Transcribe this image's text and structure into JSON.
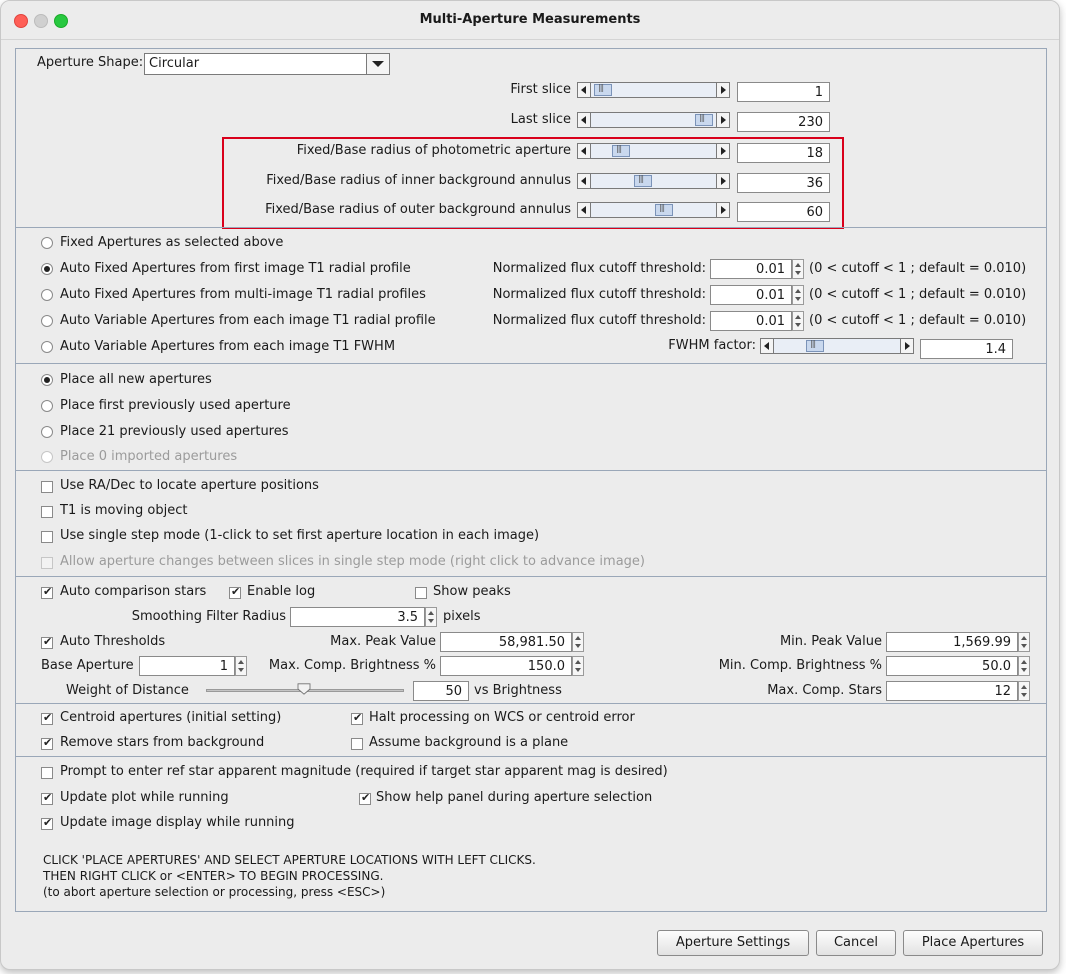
{
  "window": {
    "title": "Multi-Aperture Measurements"
  },
  "aperture_shape": {
    "label": "Aperture Shape:",
    "value": "Circular"
  },
  "sliders": {
    "first_slice": {
      "label": "First slice",
      "value": "1"
    },
    "last_slice": {
      "label": "Last slice",
      "value": "230"
    },
    "photometric": {
      "label": "Fixed/Base radius of photometric aperture",
      "value": "18"
    },
    "inner": {
      "label": "Fixed/Base radius of inner background annulus",
      "value": "36"
    },
    "outer": {
      "label": "Fixed/Base radius of outer background annulus",
      "value": "60"
    }
  },
  "aperture_mode": {
    "fixed": "Fixed Apertures as selected above",
    "auto_fixed_first": "Auto Fixed Apertures from first image T1 radial profile",
    "auto_fixed_multi": "Auto Fixed Apertures from multi-image T1 radial profiles",
    "auto_var_radial": "Auto Variable Apertures from each image T1 radial profile",
    "auto_var_fwhm": "Auto Variable Apertures from each image T1 FWHM",
    "cutoff_label": "Normalized flux cutoff threshold:",
    "cutoff_value": "0.01",
    "cutoff_hint": "(0 < cutoff < 1 ; default = 0.010)",
    "fwhm_label": "FWHM factor:",
    "fwhm_value": "1.4"
  },
  "placement": {
    "all_new": "Place all new apertures",
    "first_prev": "Place first previously used aperture",
    "prev_21": "Place 21 previously used apertures",
    "imported_0": "Place 0 imported apertures"
  },
  "options1": {
    "radec": "Use RA/Dec to locate aperture positions",
    "moving": "T1 is moving object",
    "single_step": "Use single step mode (1-click to set first aperture location in each image)",
    "allow_changes": "Allow aperture changes between slices in single step mode (right click to advance image)"
  },
  "comparison": {
    "auto_comp": "Auto comparison stars",
    "enable_log": "Enable log",
    "show_peaks": "Show peaks",
    "smoothing_label": "Smoothing Filter Radius",
    "smoothing_value": "3.5",
    "pixels": "pixels",
    "auto_thresholds": "Auto Thresholds",
    "max_peak_label": "Max. Peak Value",
    "max_peak_value": "58,981.50",
    "min_peak_label": "Min. Peak Value",
    "min_peak_value": "1,569.99",
    "base_ap_label": "Base Aperture",
    "base_ap_value": "1",
    "max_comp_label": "Max. Comp. Brightness %",
    "max_comp_value": "150.0",
    "min_comp_label": "Min. Comp. Brightness %",
    "min_comp_value": "50.0",
    "weight_label": "Weight of Distance",
    "weight_value": "50",
    "vs_brightness": "vs Brightness",
    "max_stars_label": "Max. Comp. Stars",
    "max_stars_value": "12"
  },
  "centroid": {
    "centroid_ap": "Centroid apertures (initial setting)",
    "halt": "Halt processing on WCS or centroid error",
    "remove_stars": "Remove stars from background",
    "assume_plane": "Assume background is a plane"
  },
  "misc": {
    "prompt_ref": "Prompt to enter ref star apparent magnitude (required if target star apparent mag is desired)",
    "update_plot": "Update plot while running",
    "show_help": "Show help panel during aperture selection",
    "update_image": "Update image display while running"
  },
  "instructions": {
    "line1": "CLICK 'PLACE APERTURES' AND SELECT APERTURE LOCATIONS WITH LEFT CLICKS.",
    "line2": "THEN RIGHT CLICK or <ENTER> TO BEGIN PROCESSING.",
    "line3": "(to abort aperture selection or processing, press <ESC>)"
  },
  "buttons": {
    "settings": "Aperture Settings",
    "cancel": "Cancel",
    "place": "Place Apertures"
  },
  "levels": {
    "first_slice": 0.03,
    "last_slice": 0.97,
    "photometric": 0.2,
    "inner": 0.4,
    "outer": 0.6,
    "fwhm": 0.3,
    "weight": 0.5
  },
  "colors": {
    "highlight": "#d9001b",
    "accent": "#7b93b8"
  }
}
